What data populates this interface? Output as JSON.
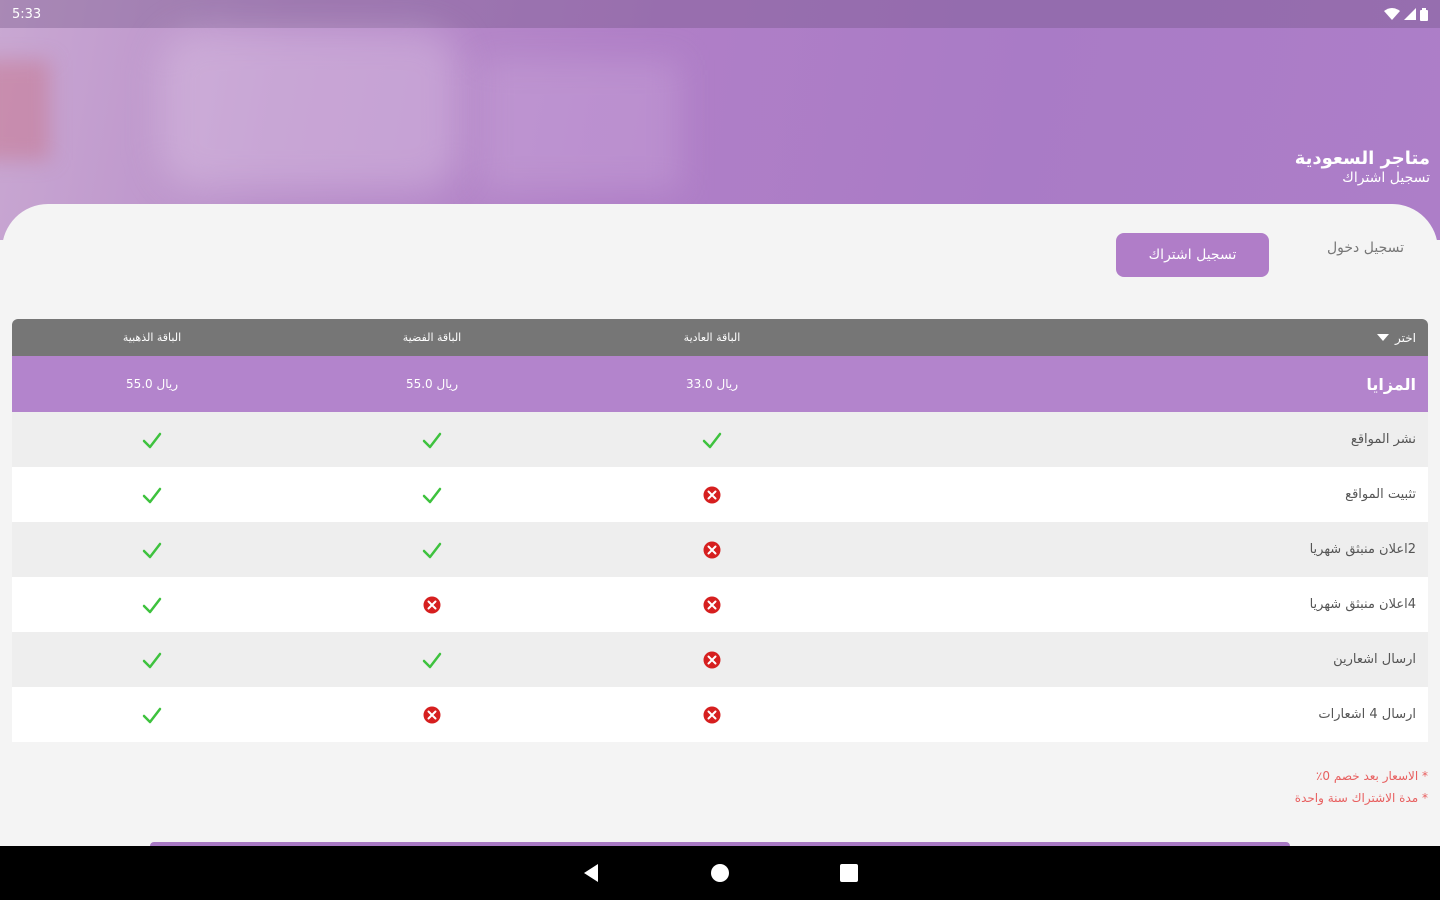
{
  "status_bar": {
    "time": "5:33",
    "icons": [
      "wifi-icon",
      "signal-icon",
      "battery-icon"
    ]
  },
  "header": {
    "title": "متاجر السعودية",
    "subtitle": "تسجيل اشتراك"
  },
  "tabs": {
    "login": "تسجيل دخول",
    "register": "تسجيل اشتراك",
    "active": "register"
  },
  "table": {
    "choose_label": "اختر",
    "plans": [
      {
        "name": "الباقة العادية",
        "price": "33.0 ريال"
      },
      {
        "name": "الباقة الفضية",
        "price": "55.0 ريال"
      },
      {
        "name": "الباقة الذهبية",
        "price": "55.0 ريال"
      }
    ],
    "features_label": "المزايا",
    "rows": [
      {
        "label": "نشر المواقع",
        "values": [
          true,
          true,
          true
        ]
      },
      {
        "label": "تثبيت المواقع",
        "values": [
          false,
          true,
          true
        ]
      },
      {
        "label": "2اعلان منبثق شهريا",
        "values": [
          false,
          true,
          true
        ]
      },
      {
        "label": "4اعلان منبثق شهريا",
        "values": [
          false,
          false,
          true
        ]
      },
      {
        "label": "ارسال اشعارين",
        "values": [
          false,
          true,
          true
        ]
      },
      {
        "label": "ارسال 4 اشعارات",
        "values": [
          false,
          false,
          true
        ]
      }
    ]
  },
  "notes": [
    "* الاسعار بعد خصم 0٪",
    "* مدة الاشتراك سنة واحدة"
  ],
  "colors": {
    "primary": "#b07dc8",
    "header_row": "#767676",
    "check": "#3ec23e",
    "cross": "#d61f1f",
    "note": "#e86060"
  },
  "nav": {
    "buttons": [
      "back-icon",
      "home-icon",
      "recents-icon"
    ]
  }
}
